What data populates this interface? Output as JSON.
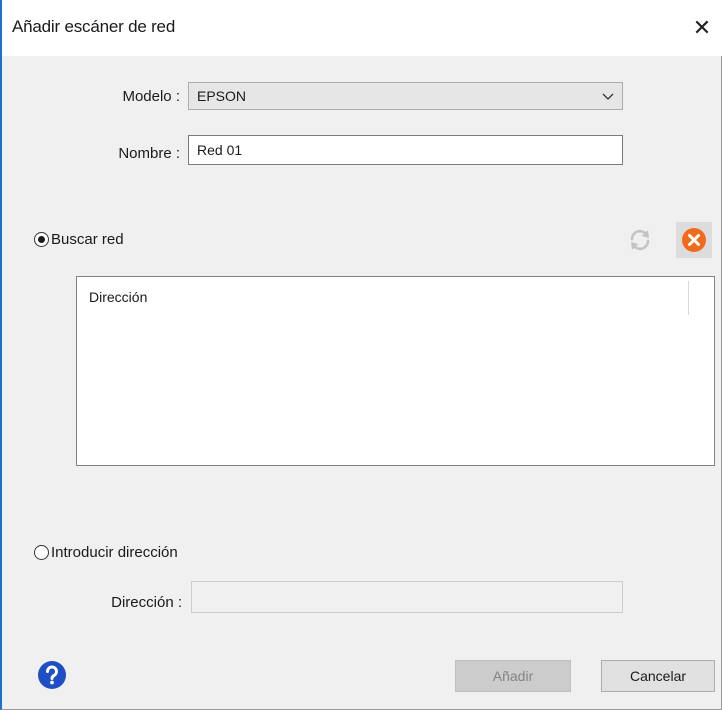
{
  "window": {
    "title": "Añadir escáner de red",
    "close_glyph": "✕"
  },
  "form": {
    "model_label": "Modelo :",
    "model_value": "EPSON",
    "name_label": "Nombre :",
    "name_value": "Red 01"
  },
  "search_network": {
    "label": "Buscar red",
    "selected": true,
    "list_column_header": "Dirección",
    "refresh_icon": "refresh-icon",
    "stop_icon": "stop-icon",
    "stop_color": "#f26b1d"
  },
  "enter_address": {
    "label": "Introducir dirección",
    "selected": false,
    "address_label": "Dirección :",
    "address_value": ""
  },
  "footer": {
    "help_icon": "help-icon",
    "help_color": "#1f4fc4",
    "add_label": "Añadir",
    "add_enabled": false,
    "cancel_label": "Cancelar"
  }
}
